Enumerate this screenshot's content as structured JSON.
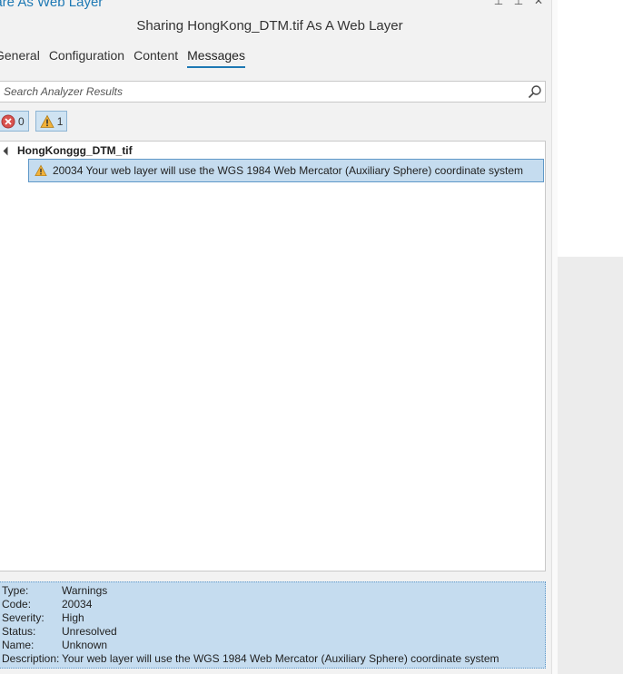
{
  "pane": {
    "title": "hare As Web Layer",
    "heading": "Sharing HongKong_DTM.tif As A Web Layer"
  },
  "tabs": [
    {
      "label": "General",
      "active": false
    },
    {
      "label": "Configuration",
      "active": false
    },
    {
      "label": "Content",
      "active": false
    },
    {
      "label": "Messages",
      "active": true
    }
  ],
  "search": {
    "placeholder": "Search Analyzer Results",
    "icon": "search-icon"
  },
  "filters": {
    "errors": {
      "icon": "error-icon",
      "count": "0"
    },
    "warnings": {
      "icon": "warning-icon",
      "count": "1"
    }
  },
  "results": {
    "group_name": "HongKonggg_DTM_tif",
    "message": "20034 Your web layer will use the WGS 1984 Web Mercator (Auxiliary Sphere) coordinate system"
  },
  "details": {
    "type_label": "Type:",
    "type_value": "Warnings",
    "code_label": "Code:",
    "code_value": "20034",
    "severity_label": "Severity:",
    "severity_value": "High",
    "status_label": "Status:",
    "status_value": "Unresolved",
    "name_label": "Name:",
    "name_value": "Unknown",
    "description_label": "Description:",
    "description_value": "Your web layer will use the WGS 1984 Web Mercator (Auxiliary Sphere) coordinate system"
  },
  "colors": {
    "accent": "#1e79b4",
    "selection": "#c5dcef",
    "warning": "#f2b23a",
    "error": "#d9534f"
  }
}
